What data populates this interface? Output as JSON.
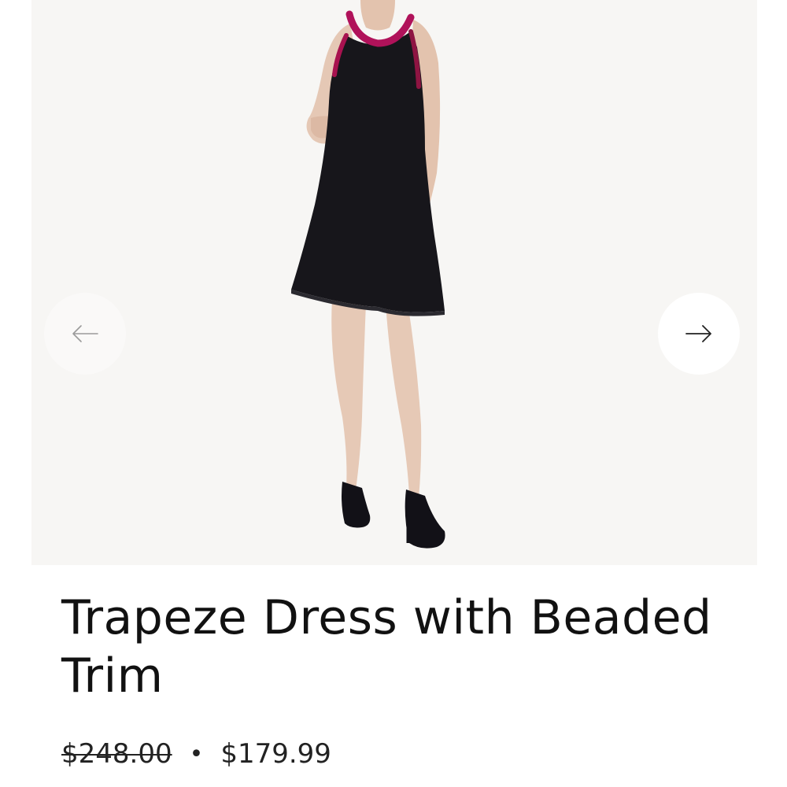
{
  "product": {
    "title": "Trapeze Dress with Beaded Trim",
    "price_original": "$248.00",
    "price_separator": "•",
    "price_sale": "$179.99"
  },
  "gallery": {
    "image_subject": "model wearing black trapeze dress with pink beaded halter trim and black strappy heels",
    "prev_icon": "arrow-left-icon",
    "next_icon": "arrow-right-icon"
  },
  "colors": {
    "gallery_background": "#f7f6f4",
    "dress": "#17161b",
    "beaded_trim": "#b0125a",
    "text": "#111111"
  }
}
